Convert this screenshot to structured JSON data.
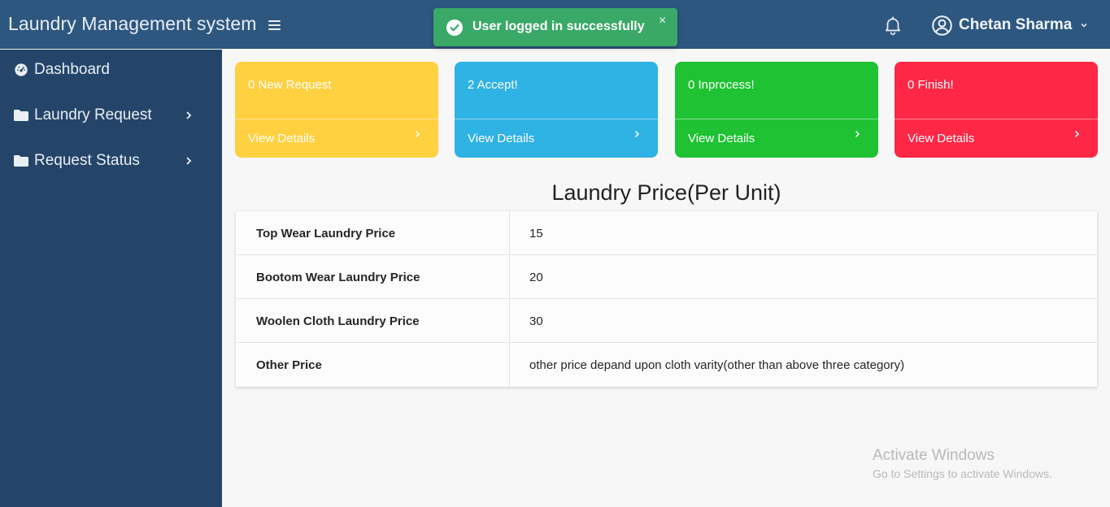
{
  "app": {
    "title": "Laundry Management system"
  },
  "toast": {
    "message": "User logged in successfully",
    "close": "×",
    "color": "#3aa968"
  },
  "user": {
    "name": "Chetan Sharma"
  },
  "sidebar": {
    "items": [
      {
        "label": "Dashboard",
        "icon": "dashboard-icon"
      },
      {
        "label": "Laundry Request",
        "icon": "folder-icon"
      },
      {
        "label": "Request Status",
        "icon": "folder-icon"
      }
    ]
  },
  "cards": [
    {
      "label": "0 New Request",
      "details": "View Details",
      "color": "#ffd040"
    },
    {
      "label": "2 Accept!",
      "details": "View Details",
      "color": "#2fb2e4"
    },
    {
      "label": "0 Inprocess!",
      "details": "View Details",
      "color": "#1ec232"
    },
    {
      "label": "0 Finish!",
      "details": "View Details",
      "color": "#fe2846"
    }
  ],
  "prices": {
    "title": "Laundry Price(Per Unit)",
    "rows": [
      {
        "label": "Top Wear Laundry Price",
        "value": "15"
      },
      {
        "label": "Bootom Wear Laundry Price",
        "value": "20"
      },
      {
        "label": "Woolen Cloth Laundry Price",
        "value": "30"
      },
      {
        "label": "Other Price",
        "value": "other price depand upon cloth varity(other than above three category)"
      }
    ]
  },
  "watermark": {
    "line1": "Activate Windows",
    "line2": "Go to Settings to activate Windows."
  }
}
